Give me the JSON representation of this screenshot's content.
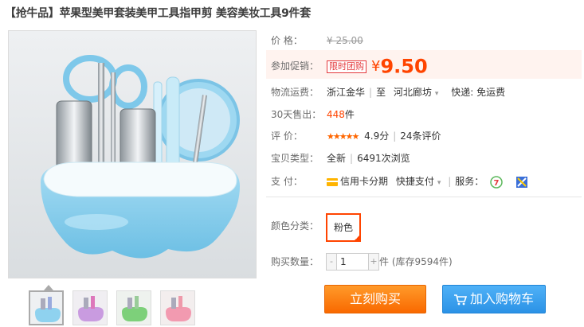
{
  "product": {
    "title": "【抢牛品】苹果型美甲套装美甲工具指甲剪 美容美妆工具9件套"
  },
  "price": {
    "label": "价 格：",
    "original": "¥ 25.00"
  },
  "promo": {
    "label": "参加促销：",
    "tag": "限时团购",
    "currency": "¥",
    "price": "9.50"
  },
  "shipping": {
    "label": "物流运费：",
    "from": "浙江金华",
    "to_prefix": "至",
    "to": "河北廊坊",
    "fee": "快递: 免运费"
  },
  "sales": {
    "label": "30天售出：",
    "count": "448",
    "unit": "件"
  },
  "rating": {
    "label": "评 价：",
    "stars": "★★★★★",
    "score": "4.9分",
    "reviews": "24条评价"
  },
  "item_type": {
    "label": "宝贝类型：",
    "condition": "全新",
    "views": "6491次浏览"
  },
  "payment": {
    "label": "支 付：",
    "method1": "信用卡分期",
    "method2": "快捷支付",
    "service_label": "服务："
  },
  "color": {
    "label": "颜色分类：",
    "selected": "粉色"
  },
  "quantity": {
    "label": "购买数量：",
    "minus": "-",
    "plus": "+",
    "value": "1",
    "stock": "件 (库存9594件)"
  },
  "actions": {
    "buy_now": "立刻购买",
    "add_to_cart": "加入购物车"
  },
  "colors": {
    "accent": "#ff4400",
    "buy_button": "#ff7a00",
    "cart_button": "#2b92e6",
    "product_blue": "#8fd2ef"
  }
}
